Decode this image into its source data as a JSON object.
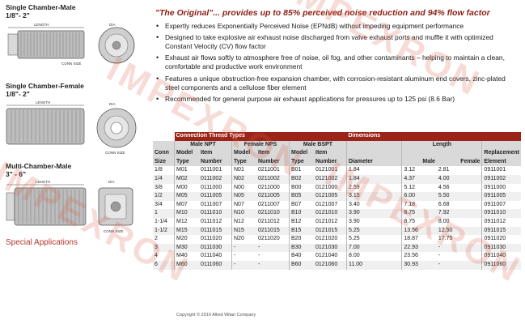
{
  "left": {
    "sections": [
      {
        "title": "Single Chamber-Male",
        "range": "1/8\"- 2\""
      },
      {
        "title": "Single Chamber-Female",
        "range": "1/8\"- 2\""
      },
      {
        "title": "Multi-Chamber-Male",
        "range": "3\" - 6\""
      }
    ],
    "labels": {
      "length": "LENGTH",
      "dia": "DIA",
      "conn_size": "CONN SIZE"
    },
    "special_applications": "Special Applications"
  },
  "headline": "\"The Original\"... provides up to 85% perceived noise reduction and 94% flow factor",
  "bullets": [
    "Expertly reduces Exponentially Perceived Noise (EPNdB) without impeding equipment performance",
    "Designed to take explosive air exhaust noise discharged from valve exhaust ports and muffle it with optimized Constant Velocity (CV) flow factor",
    "Exhaust air flows softly to atmosphere free of noise, oil fog, and other contaminants – helping to maintain a clean, comfortable and productive work environment",
    "Features a unique obstruction-free expansion chamber, with corrosion-resistant aluminum end covers, zinc-plated steel components and a cellulose fiber element",
    "Recommended for general purpose air exhaust applications for pressures up to 125 psi (8.6 Bar)"
  ],
  "table": {
    "group_headers": {
      "connection": "Connection Thread Types",
      "dimensions": "Dimensions"
    },
    "headers": {
      "conn_size": "Conn Size",
      "male_npt": "Male NPT",
      "female_nps": "Female NPS",
      "male_bspt": "Male BSPT",
      "diameter": "Diameter",
      "length": "Length",
      "replacement": "Replacement Element",
      "model_type": "Model Type",
      "item_number": "Item Number",
      "male": "Male",
      "female": "Female"
    },
    "rows": [
      [
        "1/8",
        "M01",
        "0111001",
        "N01",
        "0211001",
        "B01",
        "0121001",
        "1.84",
        "3.12",
        "2.81",
        "0911001"
      ],
      [
        "1/4",
        "M02",
        "0111002",
        "N02",
        "0211002",
        "B02",
        "0121002",
        "1.84",
        "4.37",
        "4.00",
        "0911002"
      ],
      [
        "3/8",
        "M00",
        "0111000",
        "N00",
        "0211000",
        "B00",
        "0121000",
        "2.59",
        "5.12",
        "4.56",
        "0911000"
      ],
      [
        "1/2",
        "M05",
        "0111005",
        "N05",
        "0211005",
        "B05",
        "0121005",
        "3.15",
        "6.00",
        "5.50",
        "0911005"
      ],
      [
        "3/4",
        "M07",
        "0111007",
        "N07",
        "0211007",
        "B07",
        "0121007",
        "3.40",
        "7.18",
        "6.68",
        "0911007"
      ],
      [
        "1",
        "M10",
        "0111010",
        "N10",
        "0211010",
        "B10",
        "0121010",
        "3.90",
        "8.75",
        "7.92",
        "0911010"
      ],
      [
        "1-1/4",
        "M12",
        "0111012",
        "N12",
        "0211012",
        "B12",
        "0121012",
        "3.90",
        "8.75",
        "8.00",
        "0911012"
      ],
      [
        "1-1/2",
        "M15",
        "0111015",
        "N15",
        "0211015",
        "B15",
        "0121015",
        "5.25",
        "13.56",
        "12.50",
        "0911015"
      ],
      [
        "2",
        "M20",
        "0111020",
        "N20",
        "0211020",
        "B20",
        "0121020",
        "5.25",
        "18.87",
        "17.75",
        "0911020"
      ],
      [
        "3",
        "M30",
        "0111030",
        "-",
        "-",
        "B30",
        "0121030",
        "7.00",
        "22.93",
        "-",
        "0911030"
      ],
      [
        "4",
        "M40",
        "0111040",
        "-",
        "-",
        "B40",
        "0121040",
        "8.00",
        "23.56",
        "-",
        "0911040"
      ],
      [
        "6",
        "M60",
        "0111060",
        "-",
        "-",
        "B60",
        "0121060",
        "11.00",
        "30.93",
        "-",
        "0911060"
      ]
    ]
  },
  "copyright": "Copyright © 2010 Allied Witan Company",
  "watermark": "IMPEXRON"
}
